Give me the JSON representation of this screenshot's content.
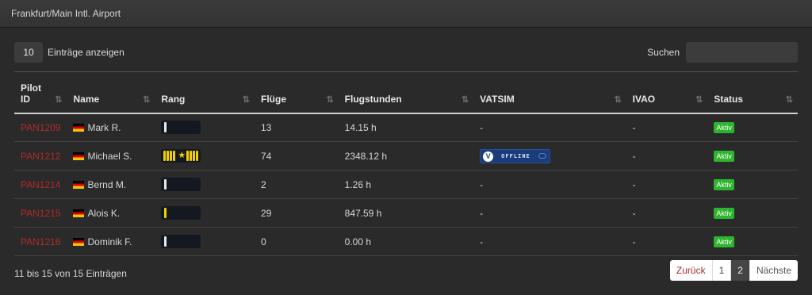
{
  "header": {
    "title": "Frankfurt/Main Intl. Airport"
  },
  "length": {
    "value": "10",
    "label": "Einträge anzeigen"
  },
  "search": {
    "label": "Suchen",
    "value": ""
  },
  "columns": [
    {
      "line1": "Pilot",
      "line2": "ID"
    },
    {
      "line1": "",
      "line2": "Name"
    },
    {
      "line1": "",
      "line2": "Rang"
    },
    {
      "line1": "",
      "line2": "Flüge"
    },
    {
      "line1": "",
      "line2": "Flugstunden"
    },
    {
      "line1": "",
      "line2": "VATSIM"
    },
    {
      "line1": "",
      "line2": "IVAO"
    },
    {
      "line1": "",
      "line2": "Status"
    }
  ],
  "sort_icon": "⇅",
  "rows": [
    {
      "id": "PAN1209",
      "name": "Mark R.",
      "rank": "white-1",
      "flights": "13",
      "hours": "14.15 h",
      "vatsim": "-",
      "ivao": "-",
      "status": "Aktiv"
    },
    {
      "id": "PAN1212",
      "name": "Michael S.",
      "rank": "gold-captain",
      "flights": "74",
      "hours": "2348.12 h",
      "vatsim": "OFFLINE",
      "ivao": "-",
      "status": "Aktiv"
    },
    {
      "id": "PAN1214",
      "name": "Bernd M.",
      "rank": "white-1",
      "flights": "2",
      "hours": "1.26 h",
      "vatsim": "-",
      "ivao": "-",
      "status": "Aktiv"
    },
    {
      "id": "PAN1215",
      "name": "Alois K.",
      "rank": "gold-1",
      "flights": "29",
      "hours": "847.59 h",
      "vatsim": "-",
      "ivao": "-",
      "status": "Aktiv"
    },
    {
      "id": "PAN1216",
      "name": "Dominik F.",
      "rank": "white-1",
      "flights": "0",
      "hours": "0.00 h",
      "vatsim": "-",
      "ivao": "-",
      "status": "Aktiv"
    }
  ],
  "info": "11 bis 15 von 15 Einträgen",
  "pagination": {
    "prev": "Zurück",
    "pages": [
      "1",
      "2"
    ],
    "current": "2",
    "next": "Nächste"
  },
  "colors": {
    "link": "#b02a2a",
    "active_badge": "#2db52d",
    "rank_gold": "#f2d000",
    "rank_white": "#e8e8e8"
  }
}
